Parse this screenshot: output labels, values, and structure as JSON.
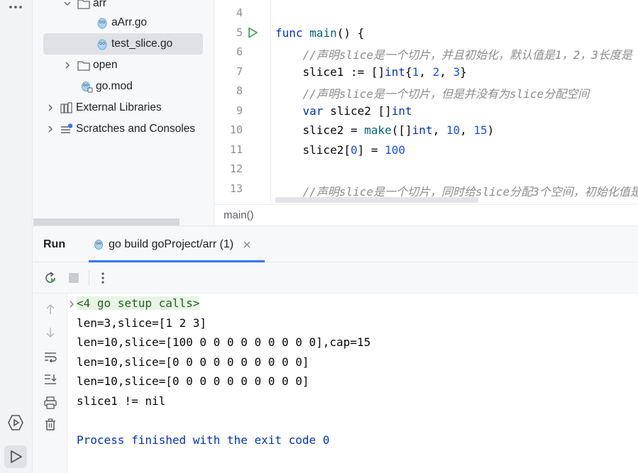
{
  "tree": {
    "items": [
      {
        "label": "arr",
        "type": "folder"
      },
      {
        "label": "aArr.go",
        "type": "go-file"
      },
      {
        "label": "test_slice.go",
        "type": "go-file"
      },
      {
        "label": "open",
        "type": "folder"
      },
      {
        "label": "go.mod",
        "type": "gomod-file"
      },
      {
        "label": "External Libraries",
        "type": "libraries"
      },
      {
        "label": "Scratches and Consoles",
        "type": "scratches"
      }
    ]
  },
  "editor": {
    "line_numbers": [
      "4",
      "5",
      "6",
      "7",
      "8",
      "9",
      "10",
      "11",
      "12",
      "13"
    ],
    "lines": [
      {
        "tokens": []
      },
      {
        "tokens": [
          {
            "t": "func ",
            "c": "kw"
          },
          {
            "t": "main",
            "c": "fn"
          },
          {
            "t": "() {",
            "c": ""
          }
        ]
      },
      {
        "tokens": [
          {
            "t": "    //声明slice是一个切片，并且初始化，默认值是1，2，3长度是",
            "c": "cmt"
          }
        ]
      },
      {
        "tokens": [
          {
            "t": "    slice1 := []",
            "c": ""
          },
          {
            "t": "int",
            "c": "kw"
          },
          {
            "t": "{",
            "c": ""
          },
          {
            "t": "1",
            "c": "num"
          },
          {
            "t": ", ",
            "c": ""
          },
          {
            "t": "2",
            "c": "num"
          },
          {
            "t": ", ",
            "c": ""
          },
          {
            "t": "3",
            "c": "num"
          },
          {
            "t": "}",
            "c": ""
          }
        ]
      },
      {
        "tokens": [
          {
            "t": "    //声明slice是一个切片，但是并没有为slice分配空间",
            "c": "cmt"
          }
        ]
      },
      {
        "tokens": [
          {
            "t": "    ",
            "c": ""
          },
          {
            "t": "var",
            "c": "kw"
          },
          {
            "t": " slice2 []",
            "c": ""
          },
          {
            "t": "int",
            "c": "kw"
          }
        ]
      },
      {
        "tokens": [
          {
            "t": "    slice2 = ",
            "c": ""
          },
          {
            "t": "make",
            "c": "fn"
          },
          {
            "t": "([]",
            "c": ""
          },
          {
            "t": "int",
            "c": "kw"
          },
          {
            "t": ", ",
            "c": ""
          },
          {
            "t": "10",
            "c": "num"
          },
          {
            "t": ", ",
            "c": ""
          },
          {
            "t": "15",
            "c": "num"
          },
          {
            "t": ")",
            "c": ""
          }
        ]
      },
      {
        "tokens": [
          {
            "t": "    slice2[",
            "c": ""
          },
          {
            "t": "0",
            "c": "num"
          },
          {
            "t": "] = ",
            "c": ""
          },
          {
            "t": "100",
            "c": "num"
          }
        ]
      },
      {
        "tokens": []
      },
      {
        "tokens": [
          {
            "t": "    //声明slice是一个切片，同时给slice分配3个空间，初始化值是",
            "c": "cmt"
          }
        ]
      }
    ],
    "breadcrumb": "main()"
  },
  "run": {
    "title": "Run",
    "tab_label": "go build goProject/arr (1)",
    "output": [
      "<4 go setup calls>",
      "len=3,slice=[1 2 3]",
      "len=10,slice=[100 0 0 0 0 0 0 0 0 0],cap=15",
      "len=10,slice=[0 0 0 0 0 0 0 0 0 0]",
      "len=10,slice=[0 0 0 0 0 0 0 0 0 0]",
      "slice1 != nil",
      "",
      "Process finished with the exit code 0"
    ]
  },
  "colors": {
    "accent": "#3574f0",
    "run_green": "#4aa55b",
    "go_blue": "#6aa8d8"
  }
}
